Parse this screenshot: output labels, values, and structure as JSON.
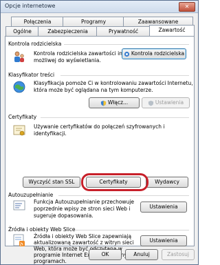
{
  "window": {
    "title": "Opcje internetowe",
    "close_label": "✕"
  },
  "tabs_row1": [
    "Połączenia",
    "Programy",
    "Zaawansowane"
  ],
  "tabs_row2": [
    "Ogólne",
    "Zabezpieczenia",
    "Prywatność",
    "Zawartość"
  ],
  "sections": {
    "parental": {
      "label": "Kontrola rodzicielska",
      "desc_line1": "Kontrola rodzicielska zawartości internetowej",
      "desc_line2": "możliwej do wyświetlania.",
      "button": "Kontrola rodzicielska"
    },
    "ratings": {
      "label": "Klasyfikator treści",
      "desc_line1": "Klasyfikacja pomoże Ci w kontrolowaniu zawartości Internetu,",
      "desc_line2": "która może być oglądana na tym komputerze.",
      "enable_button": "Włącz...",
      "settings_button": "Ustawienia"
    },
    "certificates": {
      "label": "Certyfikaty",
      "desc_line1": "Używanie certyfikatów do połączeń szyfrowanych i",
      "desc_line2": "identyfikacji.",
      "clear_ssl_button": "Wyczyść stan SSL",
      "certificates_button": "Certyfikaty",
      "publishers_button": "Wydawcy"
    },
    "autocomplete": {
      "label": "Autouzupełnianie",
      "desc_line1": "Funkcja Autouzupełnianie przechowuje",
      "desc_line2": "poprzednie wpisy ze stron sieci Web i",
      "desc_line3": "sugeruje dopasowania.",
      "button": "Ustawienia"
    },
    "feeds": {
      "label": "Źródła i obiekty Web Slice",
      "desc_line1": "Źródła i obiekty Web Slice zapewniają",
      "desc_line2": "aktualizowaną zawartość z witryn sieci",
      "desc_line3": "Web, która może być odczytana w",
      "desc_line4": "programie Internet Explorer i w innych",
      "desc_line5": "programach.",
      "button": "Ustawienia"
    }
  },
  "footer": {
    "ok": "OK",
    "cancel": "Anuluj",
    "apply": "Zastosuj"
  }
}
